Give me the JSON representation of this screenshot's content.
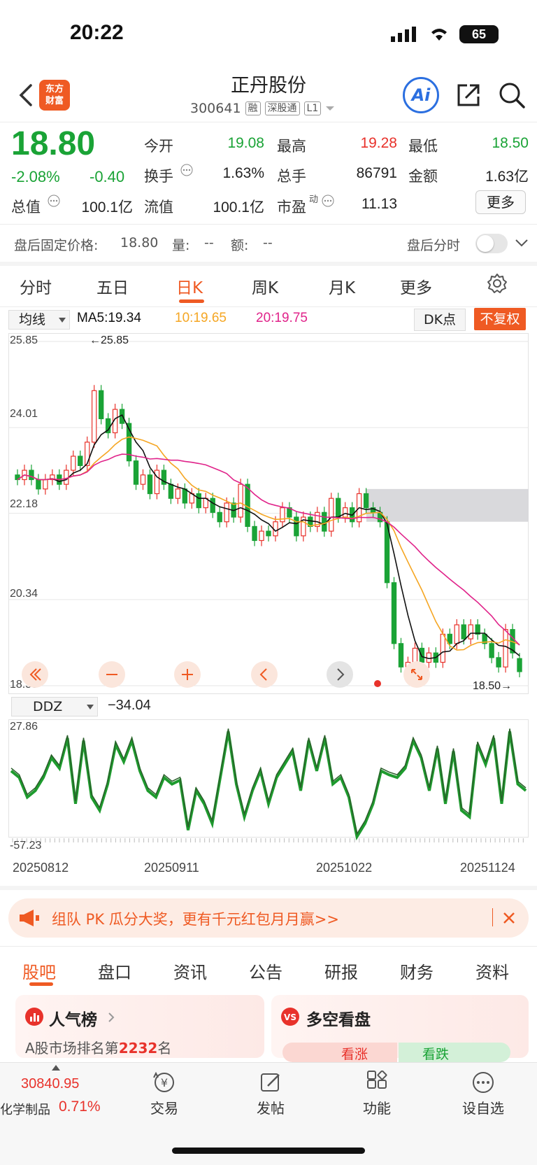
{
  "status_bar": {
    "time": "20:22",
    "battery": "65"
  },
  "header": {
    "brand_line1": "东方",
    "brand_line2": "财富",
    "stock_name": "正丹股份",
    "stock_code": "300641",
    "tags": [
      "融",
      "深股通",
      "L1"
    ],
    "ai_label": "Ai"
  },
  "quote": {
    "price": "18.80",
    "change_pct": "-2.08%",
    "change_abs": "-0.40",
    "fields": [
      {
        "label": "今开",
        "value": "19.08",
        "color": "#1aa336"
      },
      {
        "label": "最高",
        "value": "19.28",
        "color": "#e8322b"
      },
      {
        "label": "最低",
        "value": "18.50",
        "color": "#1aa336"
      },
      {
        "label": "换手",
        "value": "1.63%",
        "color": "#222222"
      },
      {
        "label": "总手",
        "value": "86791",
        "color": "#222222"
      },
      {
        "label": "金额",
        "value": "1.63亿",
        "color": "#222222"
      },
      {
        "label": "总值",
        "value": "100.1亿",
        "color": "#222222"
      },
      {
        "label": "流值",
        "value": "100.1亿",
        "color": "#222222"
      },
      {
        "label": "市盈",
        "value": "11.13",
        "color": "#222222"
      }
    ],
    "pe_superscript": "动",
    "more_button": "更多"
  },
  "after_hours": {
    "label": "盘后固定价格:",
    "price": "18.80",
    "volume_label": "量:",
    "volume": "--",
    "amount_label": "额:",
    "amount": "--",
    "toggle_label": "盘后分时"
  },
  "period_tabs": [
    "分时",
    "五日",
    "日K",
    "周K",
    "月K",
    "更多"
  ],
  "active_period": "日K",
  "ma_bar": {
    "select": "均线",
    "ma5": "MA5:19.34",
    "ma10": "10:19.65",
    "ma20": "20:19.75",
    "dk_button": "DK点",
    "fq_button": "不复权",
    "colors": {
      "ma5": "#111111",
      "ma10": "#f5a623",
      "ma20": "#e0238a"
    }
  },
  "kline_axis": [
    "25.85",
    "24.01",
    "22.18",
    "20.34",
    "18.50"
  ],
  "kline_annotations": {
    "high_label": "←25.85",
    "low_label": "18.50→"
  },
  "ddz": {
    "select": "DDZ",
    "value": "−34.04",
    "axis_max": "27.86",
    "axis_min": "-57.23"
  },
  "dates": [
    "20250812",
    "20250911",
    "20251022",
    "20251124"
  ],
  "banner": {
    "text": "组队 PK 瓜分大奖，更有千元红包月月赢>>"
  },
  "content_tabs": [
    "股吧",
    "盘口",
    "资讯",
    "公告",
    "研报",
    "财务",
    "资料"
  ],
  "active_content_tab": "股吧",
  "cards": {
    "popularity_title": "人气榜",
    "popularity_text_prefix": "A股市场排名第",
    "popularity_rank": "2232",
    "popularity_text_suffix": "名",
    "bull_bear_title": "多空看盘",
    "bull": "看涨",
    "bear": "看跌"
  },
  "bottom_bar": {
    "index_value": "30840.95",
    "index_name": "化学制品",
    "index_change": "0.71%",
    "items": [
      "交易",
      "发帖",
      "功能",
      "设自选"
    ]
  },
  "chart_data": [
    {
      "type": "candlestick",
      "title": "日K",
      "ylim": [
        18.5,
        25.85
      ],
      "y_ticks": [
        25.85,
        24.01,
        22.18,
        20.34,
        18.5
      ],
      "candles": [
        [
          23.0,
          22.9
        ],
        [
          22.9,
          23.1
        ],
        [
          23.1,
          22.9
        ],
        [
          22.9,
          22.7
        ],
        [
          22.7,
          22.9
        ],
        [
          22.9,
          23.0
        ],
        [
          23.0,
          22.8
        ],
        [
          22.8,
          23.1
        ],
        [
          23.1,
          23.4
        ],
        [
          23.4,
          23.2
        ],
        [
          23.2,
          23.7
        ],
        [
          23.7,
          24.8
        ],
        [
          24.8,
          24.2
        ],
        [
          24.2,
          23.9
        ],
        [
          23.9,
          24.4
        ],
        [
          24.4,
          24.1
        ],
        [
          24.1,
          23.3
        ],
        [
          23.3,
          22.8
        ],
        [
          22.8,
          23.0
        ],
        [
          23.0,
          22.6
        ],
        [
          22.6,
          23.1
        ],
        [
          23.1,
          22.8
        ],
        [
          22.8,
          22.5
        ],
        [
          22.5,
          22.7
        ],
        [
          22.7,
          22.4
        ],
        [
          22.4,
          22.6
        ],
        [
          22.6,
          22.3
        ],
        [
          22.3,
          22.5
        ],
        [
          22.5,
          22.2
        ],
        [
          22.2,
          22.0
        ],
        [
          22.0,
          22.4
        ],
        [
          22.4,
          22.1
        ],
        [
          22.1,
          22.8
        ],
        [
          22.8,
          21.9
        ],
        [
          21.9,
          21.6
        ],
        [
          21.6,
          21.8
        ],
        [
          21.8,
          21.7
        ],
        [
          21.7,
          22.0
        ],
        [
          22.0,
          22.3
        ],
        [
          22.3,
          22.1
        ],
        [
          22.1,
          21.7
        ],
        [
          21.7,
          22.1
        ],
        [
          22.1,
          21.9
        ],
        [
          21.9,
          22.2
        ],
        [
          22.2,
          21.8
        ],
        [
          21.8,
          22.5
        ],
        [
          22.5,
          22.1
        ],
        [
          22.1,
          22.3
        ],
        [
          22.3,
          22.0
        ],
        [
          22.0,
          22.6
        ],
        [
          22.6,
          22.3
        ],
        [
          22.3,
          22.2
        ],
        [
          22.2,
          22.0
        ],
        [
          22.0,
          20.7
        ],
        [
          20.7,
          19.4
        ],
        [
          19.4,
          18.9
        ],
        [
          18.9,
          19.0
        ],
        [
          19.0,
          19.3
        ],
        [
          19.3,
          19.0
        ],
        [
          19.0,
          19.2
        ],
        [
          19.2,
          19.0
        ],
        [
          19.0,
          19.6
        ],
        [
          19.6,
          19.4
        ],
        [
          19.4,
          19.8
        ],
        [
          19.8,
          19.5
        ],
        [
          19.5,
          19.8
        ],
        [
          19.8,
          19.6
        ],
        [
          19.6,
          19.4
        ],
        [
          19.4,
          19.1
        ],
        [
          19.1,
          18.9
        ],
        [
          18.9,
          19.7
        ],
        [
          19.7,
          19.2
        ],
        [
          19.08,
          18.8
        ]
      ],
      "ma5": "MA5:19.34",
      "ma10": "10:19.65",
      "ma20": "20:19.75"
    },
    {
      "type": "line",
      "title": "DDZ",
      "ylim": [
        -57.23,
        27.86
      ],
      "values": [
        -5,
        -10,
        -25,
        -20,
        -10,
        5,
        -3,
        20,
        -30,
        18,
        -25,
        -35,
        -15,
        15,
        2,
        18,
        -5,
        -20,
        -25,
        -10,
        -15,
        -12,
        -50,
        -20,
        -30,
        -45,
        -10,
        25,
        -15,
        -40,
        -20,
        -5,
        -30,
        -10,
        0,
        10,
        -20,
        18,
        -5,
        20,
        -15,
        -10,
        -25,
        -55,
        -45,
        -30,
        -5,
        -8,
        -10,
        -3,
        18,
        5,
        -20,
        12,
        -30,
        10,
        -35,
        -40,
        15,
        0,
        20,
        -30,
        25,
        -15,
        -20
      ]
    }
  ]
}
